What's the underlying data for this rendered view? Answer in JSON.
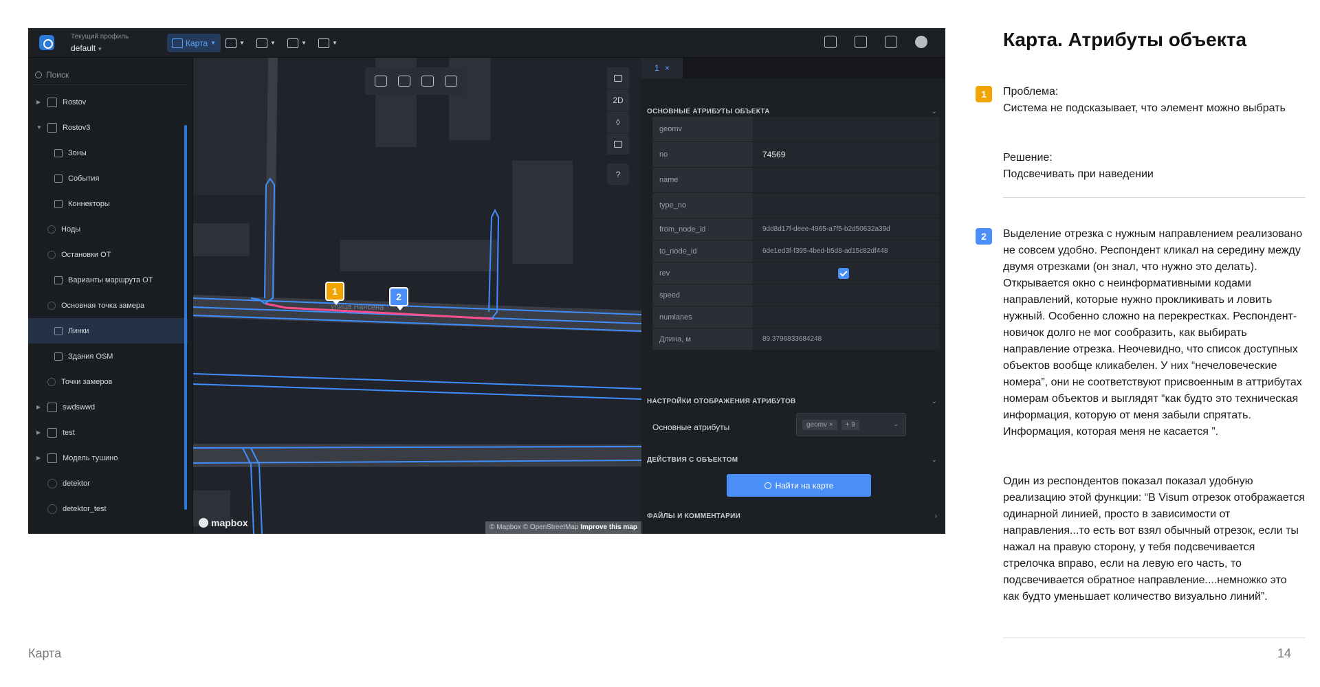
{
  "app": {
    "profile_label": "Текущий профиль",
    "profile_value": "default",
    "toolbar_map_label": "Карта",
    "search_placeholder": "Поиск"
  },
  "tree": [
    {
      "label": "Rostov",
      "type": "group",
      "expanded": false
    },
    {
      "label": "Rostov3",
      "type": "group",
      "expanded": true
    },
    {
      "label": "Зоны",
      "type": "child"
    },
    {
      "label": "События",
      "type": "child"
    },
    {
      "label": "Коннекторы",
      "type": "child"
    },
    {
      "label": "Ноды",
      "type": "leaf"
    },
    {
      "label": "Остановки ОТ",
      "type": "leaf"
    },
    {
      "label": "Варианты маршрута ОТ",
      "type": "child"
    },
    {
      "label": "Основная точка замера",
      "type": "leaf"
    },
    {
      "label": "Линки",
      "type": "child",
      "selected": true
    },
    {
      "label": "Здания OSM",
      "type": "child"
    },
    {
      "label": "Точки замеров",
      "type": "leaf"
    },
    {
      "label": "swdswwd",
      "type": "group",
      "expanded": false
    },
    {
      "label": "test",
      "type": "group",
      "expanded": false
    },
    {
      "label": "Модель тушино",
      "type": "group",
      "expanded": false
    },
    {
      "label": "detektor",
      "type": "rootleaf"
    },
    {
      "label": "detektor_test",
      "type": "rootleaf"
    }
  ],
  "map": {
    "side_2d": "2D",
    "street_name": "улица Нансена",
    "marker1": "1",
    "marker2": "2",
    "mapbox": "mapbox",
    "attribution_text": "© Mapbox © OpenStreetMap",
    "attribution_link": "Improve this map"
  },
  "panel": {
    "tab_label": "1",
    "tab_close": "×",
    "section_main": "Основные атрибуты объекта",
    "attributes": [
      {
        "key": "geomv",
        "value": ""
      },
      {
        "key": "no",
        "value": "74569"
      },
      {
        "key": "name",
        "value": ""
      },
      {
        "key": "type_no",
        "value": ""
      },
      {
        "key": "from_node_id",
        "value": "9dd8d17f-deee-4965-a7f5-b2d50632a39d"
      },
      {
        "key": "to_node_id",
        "value": "6de1ed3f-f395-4bed-b5d8-ad15c82df448"
      },
      {
        "key": "rev",
        "value": "",
        "checked": true
      },
      {
        "key": "speed",
        "value": ""
      },
      {
        "key": "numlanes",
        "value": ""
      },
      {
        "key": "Длина, м",
        "value": "89.3796833684248"
      }
    ],
    "section_display": "Настройки отображения атрибутов",
    "display_label": "Основные атрибуты",
    "chip_geomv": "geomv",
    "chip_more": "+ 9",
    "section_actions": "Действия с объектом",
    "find_button": "Найти на карте",
    "section_files": "Файлы и комментарии"
  },
  "desc": {
    "title": "Карта. Атрибуты объекта",
    "badge1": "1",
    "badge2": "2",
    "problem_label": "Проблема:",
    "problem_text": "Система не подсказывает, что элемент можно выбрать",
    "solution_label": "Решение:",
    "solution_text": "Подсвечивать при наведении",
    "point2_text": "Выделение отрезка с нужным направлением реализовано не совсем удобно. Респондент кликал на середину между двумя отрезками (он знал, что нужно это делать). Открывается окно с неинформативными кодами направлений, которые нужно прокликивать и ловить нужный. Особенно сложно на перекрестках. Респондент-новичок долго не мог сообразить, как выбирать направление отрезка. Неочевидно, что список доступных объектов вообще кликабелен. У них “нечеловеческие номера”, они не соответствуют присвоенным в аттрибутах номерам объектов и выглядят “как будто это техническая информация, которую от меня забыли спрятать. Информация, которая меня не касается ”.",
    "quote_text": "Один из респондентов показал показал удобную реализацию этой функции: “В Visum отрезок отображается одинарной линией, просто в зависимости от направления...то есть вот взял обычный отрезок, если ты нажал на правую сторону, у тебя подсвечивается стрелочка вправо, если на левую его часть, то подсвечивается обратное направление....немножко это как будто уменьшает количество визуально линий”."
  },
  "footer": {
    "section": "Карта",
    "page": "14"
  },
  "colors": {
    "accent_blue": "#4a8ff7",
    "marker_orange": "#f0a400",
    "selected_link": "#ff4f8a"
  }
}
